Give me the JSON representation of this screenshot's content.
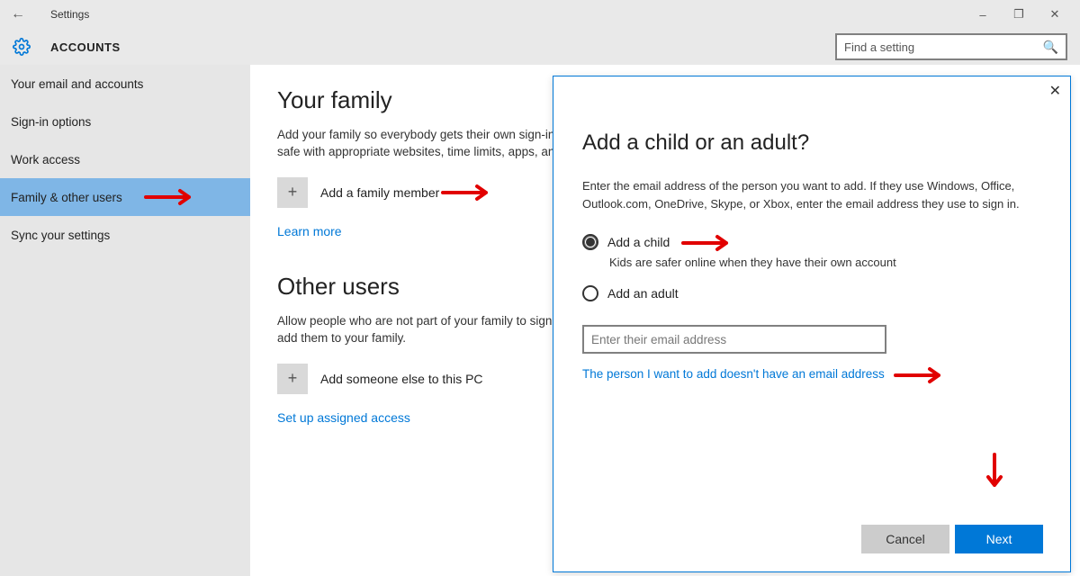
{
  "titlebar": {
    "title": "Settings"
  },
  "header": {
    "title": "ACCOUNTS",
    "search_placeholder": "Find a setting"
  },
  "sidebar": {
    "items": [
      {
        "label": "Your email and accounts",
        "selected": false
      },
      {
        "label": "Sign-in options",
        "selected": false
      },
      {
        "label": "Work access",
        "selected": false
      },
      {
        "label": "Family & other users",
        "selected": true
      },
      {
        "label": "Sync your settings",
        "selected": false
      }
    ]
  },
  "main": {
    "family_title": "Your family",
    "family_desc": "Add your family so everybody gets their own sign-in and desktop. You can help kids stay safe with appropriate websites, time limits, apps, and games.",
    "add_family_label": "Add a family member",
    "learn_more": "Learn more",
    "other_title": "Other users",
    "other_desc": "Allow people who are not part of your family to sign in with their own accounts. This won't add them to your family.",
    "add_other_label": "Add someone else to this PC",
    "assigned_access": "Set up assigned access"
  },
  "dialog": {
    "title": "Add a child or an adult?",
    "desc": "Enter the email address of the person you want to add. If they use Windows, Office, Outlook.com, OneDrive, Skype, or Xbox, enter the email address they use to sign in.",
    "radio_child": "Add a child",
    "radio_child_sub": "Kids are safer online when they have their own account",
    "radio_adult": "Add an adult",
    "email_placeholder": "Enter their email address",
    "no_email_link": "The person I want to add doesn't have an email address",
    "cancel": "Cancel",
    "next": "Next"
  }
}
